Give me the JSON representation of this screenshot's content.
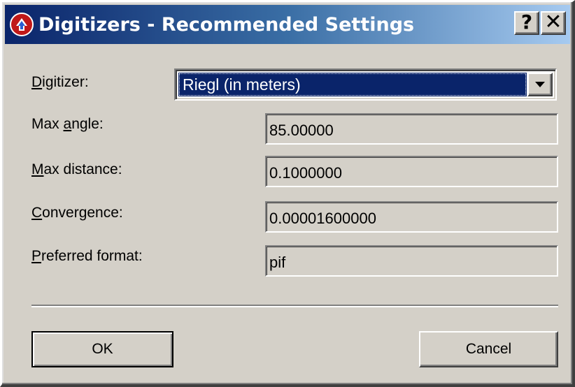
{
  "window": {
    "title": "Digitizers - Recommended Settings",
    "help_label": "?",
    "close_label": "✕",
    "app_icon": "red-pointer-hand-icon"
  },
  "form": {
    "digitizer": {
      "label": "Digitizer:",
      "mnemonic": "D",
      "label_rest": "igitizer:",
      "value": "Riegl (in meters)"
    },
    "max_angle": {
      "label": "Max angle:",
      "label_pre": "Max ",
      "mnemonic": "a",
      "label_rest": "ngle:",
      "value": "85.00000"
    },
    "max_distance": {
      "label": "Max distance:",
      "mnemonic": "M",
      "label_rest": "ax distance:",
      "value": "0.1000000"
    },
    "convergence": {
      "label": "Convergence:",
      "mnemonic": "C",
      "label_rest": "onvergence:",
      "value": "0.00001600000"
    },
    "preferred_format": {
      "label": "Preferred format:",
      "mnemonic": "P",
      "label_rest": "referred format:",
      "value": "pif"
    }
  },
  "buttons": {
    "ok": "OK",
    "cancel": "Cancel"
  },
  "colors": {
    "title_bar_start": "#0a246a",
    "title_bar_end": "#a6caf0",
    "dialog_face": "#d4d0c8",
    "selection": "#0a246a"
  }
}
